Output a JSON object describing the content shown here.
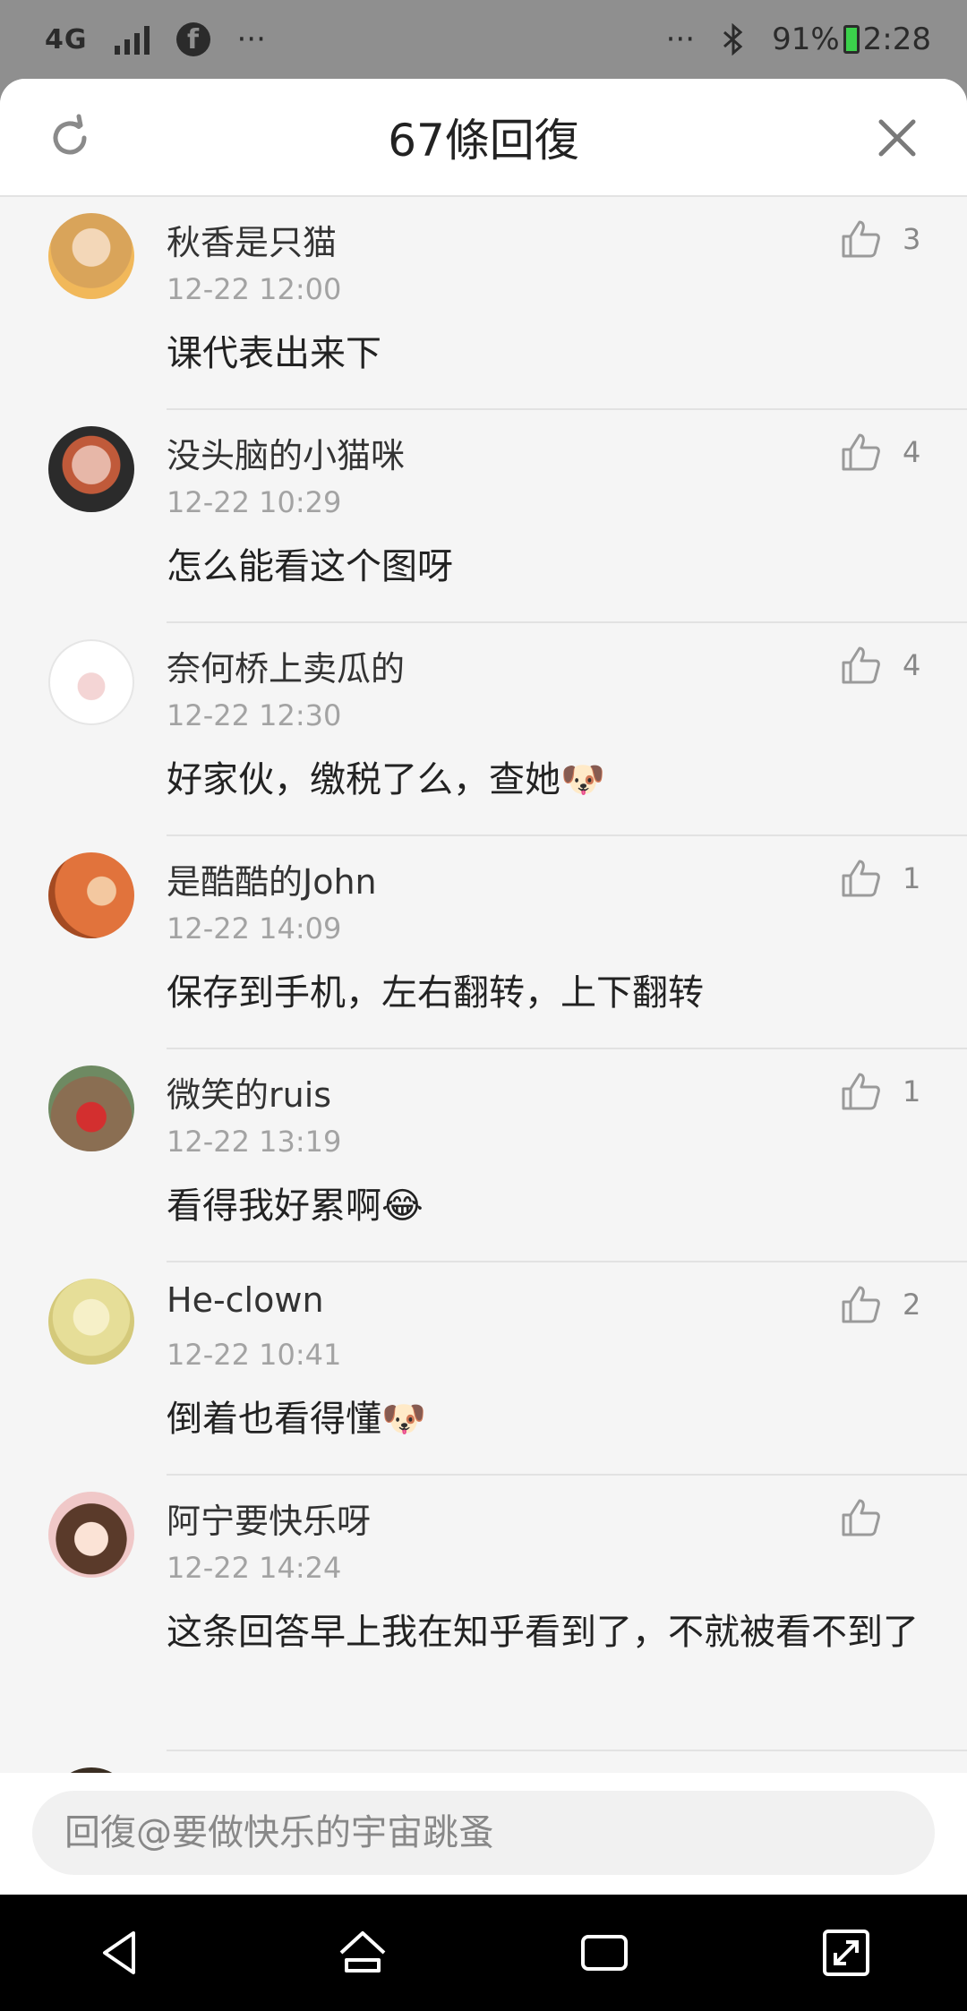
{
  "status_bar": {
    "network": "4G",
    "more_left": "···",
    "more_right": "···",
    "battery": "91%",
    "time": "2:28"
  },
  "header": {
    "title": "67條回復"
  },
  "comments": [
    {
      "name": "秋香是只猫",
      "time": "12-22 12:00",
      "text": "课代表出来下",
      "likes": "3",
      "avatar_color": "#d9a45a"
    },
    {
      "name": "没头脑的小猫咪",
      "time": "12-22 10:29",
      "text": "怎么能看这个图呀",
      "likes": "4",
      "avatar_color": "#2b2b2b"
    },
    {
      "name": "奈何桥上卖瓜的",
      "time": "12-22 12:30",
      "text": "好家伙，缴税了么，查她🐶",
      "likes": "4",
      "avatar_color": "#ffffff"
    },
    {
      "name": "是酷酷的John",
      "time": "12-22 14:09",
      "text": "保存到手机，左右翻转，上下翻转",
      "likes": "1",
      "avatar_color": "#e1733c"
    },
    {
      "name": "微笑的ruis",
      "time": "12-22 13:19",
      "text": "看得我好累啊😂",
      "likes": "1",
      "avatar_color": "#8a6e52"
    },
    {
      "name": "He-clown",
      "time": "12-22 10:41",
      "text": "倒着也看得懂🐶",
      "likes": "2",
      "avatar_color": "#e6de98"
    },
    {
      "name": "阿宁要快乐呀",
      "time": "12-22 14:24",
      "text": "这条回答早上我在知乎看到了，不就被看不到了",
      "likes": "",
      "avatar_color": "#f0c8c8"
    }
  ],
  "reply": {
    "placeholder": "回復@要做快乐的宇宙跳蚤"
  },
  "colors": {
    "accent_gray": "#8f8f8f",
    "sheet_bg": "#f5f5f5"
  }
}
